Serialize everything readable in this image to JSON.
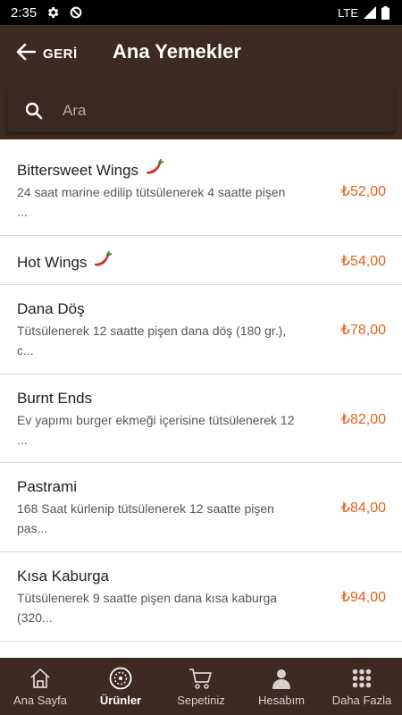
{
  "status_bar": {
    "time": "2:35",
    "network": "LTE"
  },
  "header": {
    "back_label": "GERİ",
    "title": "Ana Yemekler"
  },
  "search": {
    "placeholder": "Ara"
  },
  "colors": {
    "header_bg": "#3e2a20",
    "price": "#e65f1d",
    "text": "#212121"
  },
  "menu": {
    "items": [
      {
        "name": "Bittersweet Wings",
        "spicy": true,
        "desc": "24 saat marine edilip tütsülenerek 4 saatte pişen\n...",
        "price": "₺52,00"
      },
      {
        "name": "Hot Wings",
        "spicy": true,
        "desc": "",
        "price": "₺54,00"
      },
      {
        "name": "Dana Döş",
        "spicy": false,
        "desc": "Tütsülenerek 12 saatte pişen dana döş (180 gr.),\nc...",
        "price": "₺78,00"
      },
      {
        "name": "Burnt Ends",
        "spicy": false,
        "desc": "Ev yapımı burger ekmeği içerisine tütsülenerek 12\n...",
        "price": "₺82,00"
      },
      {
        "name": "Pastrami",
        "spicy": false,
        "desc": "168 Saat kürlenip tütsülenerek 12 saatte pişen\npas...",
        "price": "₺84,00"
      },
      {
        "name": "Kısa Kaburga",
        "spicy": false,
        "desc": "Tütsülenerek 9 saatte pişen dana kısa kaburga\n(320...",
        "price": "₺94,00"
      }
    ]
  },
  "bottom_nav": {
    "items": [
      {
        "label": "Ana Sayfa",
        "icon": "home-icon"
      },
      {
        "label": "Ürünler",
        "icon": "menu-plate-icon"
      },
      {
        "label": "Sepetiniz",
        "icon": "cart-icon"
      },
      {
        "label": "Hesabım",
        "icon": "user-icon"
      },
      {
        "label": "Daha Fazla",
        "icon": "grid-dots-icon"
      }
    ]
  }
}
